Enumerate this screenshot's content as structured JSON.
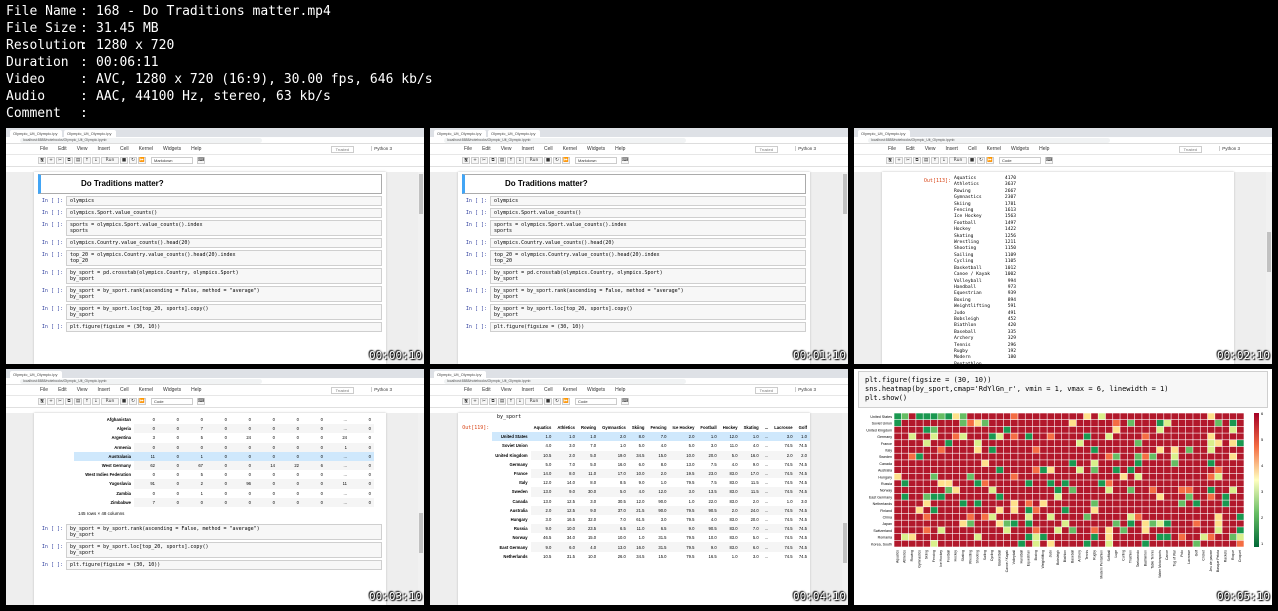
{
  "file_info": [
    {
      "key": "File Name",
      "value": "168 - Do Traditions matter.mp4"
    },
    {
      "key": "File Size",
      "value": "31.45 MB"
    },
    {
      "key": "Resolution",
      "value": "1280 x 720"
    },
    {
      "key": "Duration",
      "value": "00:06:11"
    },
    {
      "key": "Video",
      "value": "AVC, 1280 x 720 (16:9), 30.00 fps, 646 kb/s"
    },
    {
      "key": "Audio",
      "value": "AAC, 44100 Hz, stereo, 63 kb/s"
    },
    {
      "key": "Comment",
      "value": ""
    }
  ],
  "separator": ":",
  "timestamps": [
    "00:00:10",
    "00:01:10",
    "00:02:10",
    "00:03:10",
    "00:04:10",
    "00:05:10"
  ],
  "browser": {
    "tab_label": "Olympic_Ult_Olympic.ipy",
    "tab2_label": "Olympic_Ult_Olympic.ipy",
    "address": "localhost:8888/notebooks/Olympic_Ult_Olympic.ipynb"
  },
  "jupyter": {
    "menu": [
      "File",
      "Edit",
      "View",
      "Insert",
      "Cell",
      "Kernel",
      "Widgets",
      "Help"
    ],
    "trusted": "Trusted",
    "kernel": "Python 3",
    "run_label": "Run",
    "cell_type_markdown": "Markdown",
    "cell_type_code": "Code"
  },
  "notebook": {
    "heading": "Do Traditions matter?",
    "prompt_empty": "In [ ]:",
    "cells": [
      "olympics",
      "olympics.Sport.value_counts()",
      "sports = olympics.Sport.value_counts().index\nsports",
      "olympics.Country.value_counts().head(20)",
      "top_20 = olympics.Country.value_counts().head(20).index\ntop_20",
      "by_sport = pd.crosstab(olympics.Country, olympics.Sport)\nby_sport",
      "by_sport = by_sport.rank(ascending = False, method = \"average\")\nby_sport",
      "by_sport = by_sport.loc[top_20, sports].copy()\nby_sport",
      "plt.figure(figsize = (30, 10))"
    ]
  },
  "value_counts": {
    "out_prompt": "Out[113]:",
    "rows": [
      [
        "Aquatics",
        "4170"
      ],
      [
        "Athletics",
        "3637"
      ],
      [
        "Rowing",
        "2667"
      ],
      [
        "Gymnastics",
        "2307"
      ],
      [
        "Skiing",
        "1781"
      ],
      [
        "Fencing",
        "1613"
      ],
      [
        "Ice Hockey",
        "1563"
      ],
      [
        "Football",
        "1497"
      ],
      [
        "Hockey",
        "1422"
      ],
      [
        "Skating",
        "1256"
      ],
      [
        "Wrestling",
        "1211"
      ],
      [
        "Shooting",
        "1150"
      ],
      [
        "Sailing",
        "1109"
      ],
      [
        "Cycling",
        "1105"
      ],
      [
        "Basketball",
        "1012"
      ],
      [
        "Canoe / Kayak",
        "1002"
      ],
      [
        "Volleyball",
        "994"
      ],
      [
        "Handball",
        "973"
      ],
      [
        "Equestrian",
        "939"
      ],
      [
        "Boxing",
        "894"
      ],
      [
        "Weightlifting",
        "591"
      ],
      [
        "Judo",
        "491"
      ],
      [
        "Bobsleigh",
        "452"
      ],
      [
        "Biathlon",
        "420"
      ],
      [
        "Baseball",
        "335"
      ],
      [
        "Archery",
        "329"
      ],
      [
        "Tennis",
        "296"
      ],
      [
        "Rugby",
        "192"
      ],
      [
        "Modern Pentathlon",
        "180"
      ]
    ]
  },
  "crosstab": {
    "rows": [
      [
        "Afghanistan",
        "0",
        "0",
        "0",
        "0",
        "0",
        "0",
        "0",
        "0",
        "...",
        "0"
      ],
      [
        "Algeria",
        "0",
        "0",
        "7",
        "0",
        "0",
        "0",
        "0",
        "0",
        "...",
        "0"
      ],
      [
        "Argentina",
        "3",
        "0",
        "5",
        "0",
        "24",
        "0",
        "0",
        "0",
        "24",
        "0"
      ],
      [
        "Armenia",
        "0",
        "0",
        "0",
        "0",
        "0",
        "0",
        "0",
        "0",
        "1",
        "0"
      ],
      [
        "Australasia",
        "11",
        "0",
        "1",
        "0",
        "0",
        "0",
        "0",
        "0",
        "...",
        "0"
      ],
      [
        "West Germany",
        "62",
        "0",
        "67",
        "0",
        "0",
        "14",
        "22",
        "6",
        "...",
        "0"
      ],
      [
        "West Indies Federation",
        "0",
        "0",
        "5",
        "0",
        "0",
        "0",
        "0",
        "0",
        "...",
        "0"
      ],
      [
        "Yugoslavia",
        "91",
        "0",
        "2",
        "0",
        "96",
        "0",
        "0",
        "0",
        "11",
        "0"
      ],
      [
        "Zambia",
        "0",
        "0",
        "1",
        "0",
        "0",
        "0",
        "0",
        "0",
        "...",
        "0"
      ],
      [
        "Zimbabwe",
        "7",
        "0",
        "0",
        "0",
        "0",
        "0",
        "0",
        "0",
        "...",
        "0"
      ]
    ],
    "footer": "145 rows × 48 columns"
  },
  "ranked": {
    "out_prompt": "Out[119]:",
    "columns": [
      "Aquatics",
      "Athletics",
      "Rowing",
      "Gymnastics",
      "Skiing",
      "Fencing",
      "Ice Hockey",
      "Football",
      "Hockey",
      "Skating",
      "...",
      "Lacrosse",
      "Golf"
    ],
    "rows": [
      [
        "United States",
        "1.0",
        "1.0",
        "1.0",
        "2.0",
        "8.0",
        "7.0",
        "2.0",
        "1.0",
        "12.0",
        "1.0",
        "...",
        "3.0",
        "1.0"
      ],
      [
        "Soviet Union",
        "4.0",
        "3.0",
        "7.0",
        "1.0",
        "5.0",
        "4.0",
        "5.0",
        "3.0",
        "11.0",
        "4.0",
        "...",
        "74.5",
        "74.5"
      ],
      [
        "United Kingdom",
        "10.5",
        "2.0",
        "5.0",
        "19.0",
        "34.5",
        "15.0",
        "10.0",
        "20.0",
        "5.0",
        "16.0",
        "...",
        "2.0",
        "2.0"
      ],
      [
        "Germany",
        "5.0",
        "7.0",
        "5.0",
        "16.0",
        "6.0",
        "8.0",
        "13.0",
        "7.5",
        "4.0",
        "9.0",
        "...",
        "74.5",
        "74.5"
      ],
      [
        "France",
        "14.0",
        "8.0",
        "11.0",
        "17.0",
        "10.0",
        "2.0",
        "19.5",
        "23.0",
        "83.0",
        "17.0",
        "...",
        "74.5",
        "74.5"
      ],
      [
        "Italy",
        "12.0",
        "14.0",
        "8.0",
        "8.5",
        "9.0",
        "1.0",
        "79.5",
        "7.5",
        "83.0",
        "11.5",
        "...",
        "74.5",
        "74.5"
      ],
      [
        "Sweden",
        "13.0",
        "9.0",
        "30.0",
        "5.0",
        "4.0",
        "12.0",
        "3.0",
        "13.5",
        "83.0",
        "11.5",
        "...",
        "74.5",
        "74.5"
      ],
      [
        "Canada",
        "13.0",
        "12.5",
        "3.0",
        "30.5",
        "12.0",
        "90.0",
        "1.0",
        "22.0",
        "83.0",
        "2.0",
        "...",
        "1.0",
        "3.0"
      ],
      [
        "Australia",
        "2.0",
        "12.5",
        "9.0",
        "37.0",
        "21.5",
        "90.0",
        "79.5",
        "90.5",
        "2.0",
        "24.0",
        "...",
        "74.5",
        "74.5"
      ],
      [
        "Hungary",
        "3.0",
        "16.5",
        "32.0",
        "7.0",
        "61.5",
        "3.0",
        "79.5",
        "4.0",
        "83.0",
        "20.0",
        "...",
        "74.5",
        "74.5"
      ],
      [
        "Russia",
        "9.0",
        "10.0",
        "23.5",
        "6.5",
        "11.0",
        "6.5",
        "9.0",
        "90.5",
        "83.0",
        "7.0",
        "...",
        "74.5",
        "74.5"
      ],
      [
        "Norway",
        "46.5",
        "34.0",
        "15.0",
        "10.0",
        "1.0",
        "31.5",
        "79.5",
        "10.0",
        "83.0",
        "5.0",
        "...",
        "74.5",
        "74.5"
      ],
      [
        "East Germany",
        "9.0",
        "6.0",
        "4.0",
        "13.0",
        "16.0",
        "31.5",
        "79.5",
        "9.0",
        "83.0",
        "6.0",
        "...",
        "74.5",
        "74.5"
      ],
      [
        "Netherlands",
        "10.5",
        "31.5",
        "10.0",
        "26.0",
        "34.5",
        "15.0",
        "79.5",
        "16.5",
        "1.0",
        "3.0",
        "...",
        "74.5",
        "74.5"
      ]
    ]
  },
  "heatmap_code": [
    "plt.figure(figsize = (30, 10))",
    "sns.heatmap(by_sport,cmap='RdYlGn_r', vmin = 1, vmax = 6, linewidth = 1)",
    "plt.show()"
  ],
  "chart_data": {
    "type": "heatmap",
    "y_categories": [
      "United States",
      "Soviet Union",
      "United Kingdom",
      "Germany",
      "France",
      "Italy",
      "Sweden",
      "Canada",
      "Australia",
      "Hungary",
      "Russia",
      "Norway",
      "East Germany",
      "Netherlands",
      "Finland",
      "China",
      "Japan",
      "Switzerland",
      "Romania",
      "Korea, South"
    ],
    "x_categories": [
      "Aquatics",
      "Athletics",
      "Rowing",
      "Gymnastics",
      "Skiing",
      "Fencing",
      "Ice Hockey",
      "Football",
      "Hockey",
      "Skating",
      "Wrestling",
      "Shooting",
      "Sailing",
      "Cycling",
      "Basketball",
      "Canoe / Kayak",
      "Volleyball",
      "Handball",
      "Equestrian",
      "Boxing",
      "Weightlifting",
      "Judo",
      "Bobsleigh",
      "Biathlon",
      "Baseball",
      "Archery",
      "Tennis",
      "Rugby",
      "Modern Pentathlon",
      "Softball",
      "Luge",
      "Curling",
      "Triathlon",
      "Taekwondo",
      "Badminton",
      "Table Tennis",
      "Water Motorsports",
      "Canoe",
      "Tug of War",
      "Polo",
      "Lacrosse",
      "Golf",
      "Cricket",
      "Jeu de paume",
      "Basque Pelota",
      "Rackets",
      "Roque",
      "Croquet"
    ],
    "colorbar_ticks": [
      "6",
      "5",
      "4",
      "3",
      "2",
      "1"
    ],
    "vmin": 1,
    "vmax": 6,
    "cmap": "RdYlGn_r"
  }
}
